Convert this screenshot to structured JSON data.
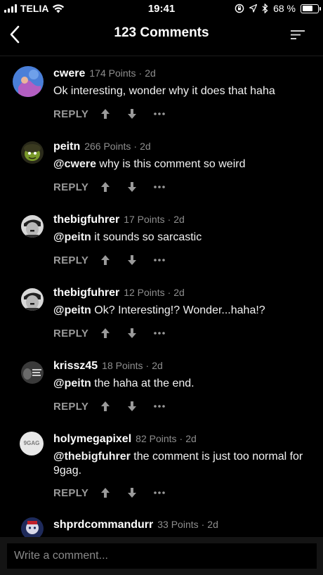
{
  "status_bar": {
    "carrier": "TELIA",
    "time": "19:41",
    "battery_text": "68 %",
    "battery_level": 0.68
  },
  "nav": {
    "title": "123 Comments",
    "back_icon": "chevron-left-icon",
    "sort_icon": "sort-icon"
  },
  "comments": [
    {
      "user": "cwere",
      "points": "174 Points",
      "age": "2d",
      "mention": "",
      "text": "Ok interesting, wonder why it does that haha",
      "reply": "REPLY"
    },
    {
      "user": "peitn",
      "points": "266 Points",
      "age": "2d",
      "mention": "@cwere",
      "text": " why is this comment so weird",
      "reply": "REPLY"
    },
    {
      "user": "thebigfuhrer",
      "points": "17 Points",
      "age": "2d",
      "mention": "@peitn",
      "text": " it sounds so sarcastic",
      "reply": "REPLY"
    },
    {
      "user": "thebigfuhrer",
      "points": "12 Points",
      "age": "2d",
      "mention": "@peitn",
      "text": " Ok? Interesting!? Wonder...haha!?",
      "reply": "REPLY"
    },
    {
      "user": "krissz45",
      "points": "18 Points",
      "age": "2d",
      "mention": "@peitn",
      "text": " the haha at the end.",
      "reply": "REPLY"
    },
    {
      "user": "holymegapixel",
      "points": "82 Points",
      "age": "2d",
      "mention": "@thebigfuhrer",
      "text": " the comment is just too normal for 9gag.",
      "reply": "REPLY",
      "avatar_text": "9GAG"
    },
    {
      "user": "shprdcommandurr",
      "points": "33 Points",
      "age": "2d"
    }
  ],
  "composer": {
    "placeholder": "Write a comment..."
  },
  "colors": {
    "background": "#000000",
    "meta_text": "#8e8e8e",
    "action_text": "#9a9a9a",
    "composer_bg": "#141414"
  }
}
